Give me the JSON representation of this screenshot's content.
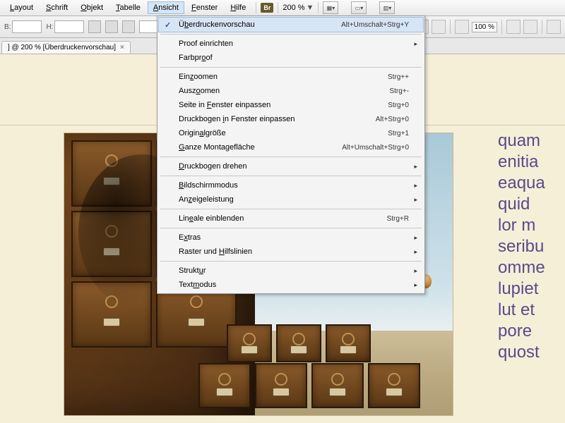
{
  "menubar": {
    "items": [
      {
        "u": "L",
        "rest": "ayout"
      },
      {
        "u": "S",
        "rest": "chrift"
      },
      {
        "u": "O",
        "rest": "bjekt"
      },
      {
        "u": "T",
        "rest": "abelle"
      },
      {
        "u": "A",
        "rest": "nsicht"
      },
      {
        "u": "F",
        "rest": "enster"
      },
      {
        "u": "H",
        "rest": "ilfe"
      }
    ],
    "br": "Br",
    "zoom": "200 %"
  },
  "toolbar": {
    "b": "B:",
    "h": "H:"
  },
  "tbright": {
    "pct": "100 %"
  },
  "tab": {
    "title": "] @ 200 % [Überdruckenvorschau]",
    "close": "×"
  },
  "menu": {
    "overprint": {
      "label_pre": "Ü",
      "label_u": "b",
      "label_post": "erdruckenvorschau",
      "short": "Alt+Umschalt+Strg+Y"
    },
    "proof_setup": {
      "label": "Proof einrichten"
    },
    "proof_colors": {
      "label_pre": "Farbpr",
      "label_u": "o",
      "label_post": "of"
    },
    "zoom_in": {
      "label_pre": "Ein",
      "label_u": "z",
      "label_post": "oomen",
      "short": "Strg++"
    },
    "zoom_out": {
      "label_pre": "Ausz",
      "label_u": "o",
      "label_post": "omen",
      "short": "Strg+-"
    },
    "fit_page": {
      "label_pre": "Seite in ",
      "label_u": "F",
      "label_post": "enster einpassen",
      "short": "Strg+0"
    },
    "fit_spread": {
      "label_pre": "Druckbogen ",
      "label_u": "i",
      "label_post": "n Fenster einpassen",
      "short": "Alt+Strg+0"
    },
    "actual_size": {
      "label_pre": "Origin",
      "label_u": "a",
      "label_post": "lgröße",
      "short": "Strg+1"
    },
    "entire_paste": {
      "label_pre": "",
      "label_u": "G",
      "label_post": "anze Montagefläche",
      "short": "Alt+Umschalt+Strg+0"
    },
    "rotate": {
      "label_pre": "",
      "label_u": "D",
      "label_post": "ruckbogen drehen"
    },
    "screen_mode": {
      "label_pre": "",
      "label_u": "B",
      "label_post": "ildschirmmodus"
    },
    "display_perf": {
      "label_pre": "An",
      "label_u": "z",
      "label_post": "eigeleistung"
    },
    "show_rulers": {
      "label_pre": "Lin",
      "label_u": "e",
      "label_post": "ale einblenden",
      "short": "Strg+R"
    },
    "extras": {
      "label_pre": "E",
      "label_u": "x",
      "label_post": "tras"
    },
    "grids": {
      "label_pre": "Raster und ",
      "label_u": "H",
      "label_post": "ilfslinien"
    },
    "structure": {
      "label_pre": "Strukt",
      "label_u": "u",
      "label_post": "r"
    },
    "story": {
      "label_pre": "Text",
      "label_u": "m",
      "label_post": "odus"
    }
  },
  "bodytext": "quam\nenitia\neaqua\nquid\nlor m\nseribu\nomme\nlupiet\nlut et\npore\nquost"
}
